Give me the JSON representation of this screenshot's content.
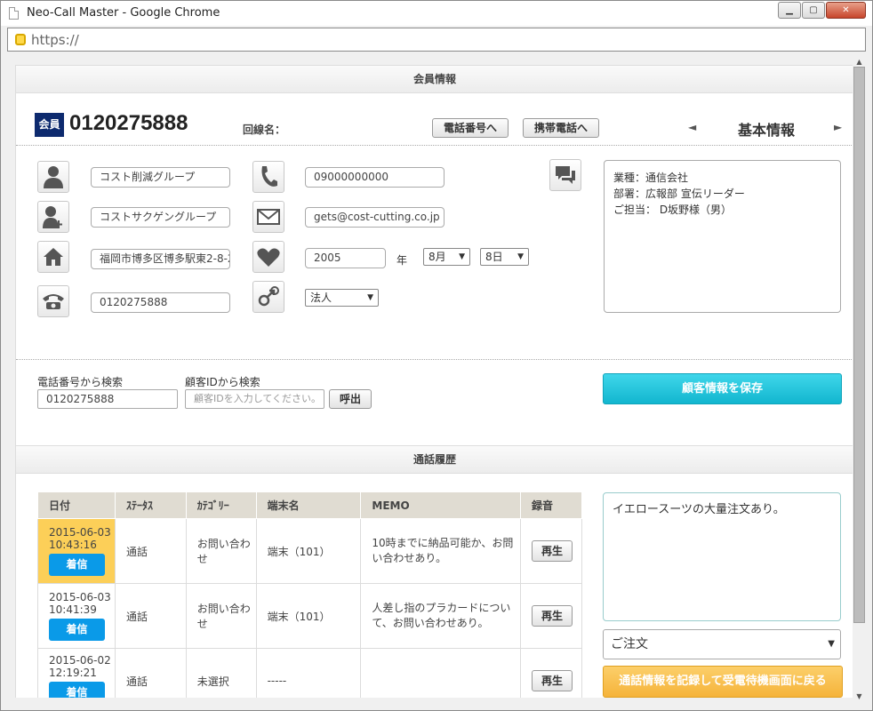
{
  "window": {
    "title": "Neo-Call Master - Google Chrome",
    "url": "https://"
  },
  "member_section": {
    "title": "会員情報"
  },
  "member": {
    "badge": "会員",
    "phone": "0120275888",
    "line_label": "回線名：",
    "btn_phone": "電話番号へ",
    "btn_mobile": "携帯電話へ",
    "nav_prev": "◄",
    "basic_info": "基本情報",
    "nav_next": "►"
  },
  "fields": {
    "name": "コスト削減グループ",
    "name_kana": "コストサクゲングループ",
    "address": "福岡市博多区博多駅東2-8-2",
    "tel": "0120275888",
    "mobile": "09000000000",
    "email": "gets@cost-cutting.co.jp",
    "birth_year": "2005",
    "year_label": "年",
    "birth_month": "8月",
    "birth_day": "8日",
    "type": "法人"
  },
  "notes": [
    "業種：通信会社",
    "部署：広報部 宣伝リーダー",
    "ご担当：  D坂野様（男）"
  ],
  "search": {
    "phone_label": "電話番号から検索",
    "phone_value": "0120275888",
    "id_label": "顧客IDから検索",
    "id_placeholder": "顧客IDを入力してください。",
    "call_btn": "呼出"
  },
  "save_btn": "顧客情報を保存",
  "history_section": {
    "title": "通話履歴"
  },
  "history": {
    "headers": [
      "日付",
      "ｽﾃｰﾀｽ",
      "ｶﾃｺﾞﾘｰ",
      "端末名",
      "MEMO",
      "録音"
    ],
    "rows": [
      {
        "date": "2015-06-03",
        "time": "10:43:16",
        "badge": "着信",
        "status": "通話",
        "category": "お問い合わせ",
        "terminal": "端末（101）",
        "memo": "10時までに納品可能か、お問い合わせあり。",
        "play": "再生"
      },
      {
        "date": "2015-06-03",
        "time": "10:41:39",
        "badge": "着信",
        "status": "通話",
        "category": "お問い合わせ",
        "terminal": "端末（101）",
        "memo": "人差し指のプラカードについて、お問い合わせあり。",
        "play": "再生"
      },
      {
        "date": "2015-06-02",
        "time": "12:19:21",
        "badge": "着信",
        "status": "通話",
        "category": "未選択",
        "terminal": "-----",
        "memo": "",
        "play": "再生"
      }
    ]
  },
  "call_note": "イエロースーツの大量注文あり。",
  "order_select": "ご注文",
  "return_btn": "通話情報を記録して受電待機画面に戻る",
  "icons": {
    "person": "person-icon",
    "person_add": "person-add-icon",
    "home": "home-icon",
    "telephone": "telephone-icon",
    "mobile": "mobile-phone-icon",
    "mail": "mail-icon",
    "heart": "heart-icon",
    "gender": "gender-icon",
    "chat": "chat-icon"
  },
  "colors": {
    "badge": "#0d2a6e",
    "save": "#1ec3da",
    "incoming": "#0a9ae8",
    "highlight": "#fccf58",
    "return": "#f5b33a"
  }
}
